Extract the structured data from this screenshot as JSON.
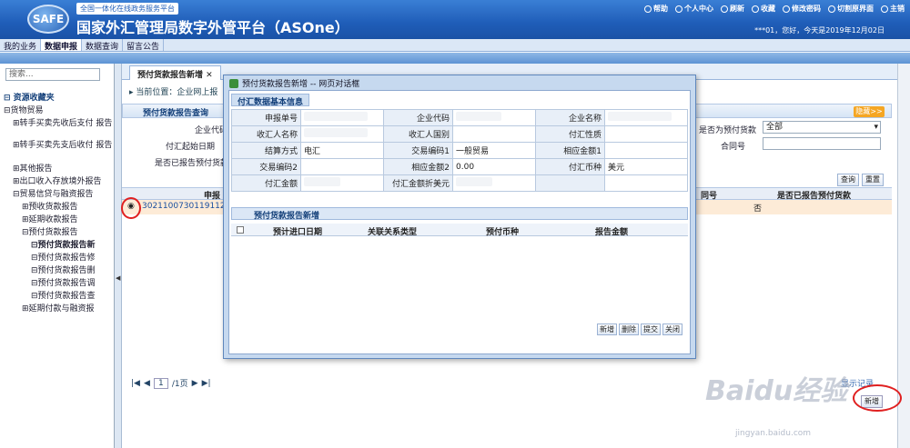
{
  "header": {
    "logo": "SAFE",
    "slogan": "全国一体化在线政务服务平台",
    "title": "国家外汇管理局数字外管平台（ASOne）",
    "links": [
      "帮助",
      "个人中心",
      "刷新",
      "收藏",
      "修改密码",
      "切割原界面",
      "主销"
    ],
    "user_info": "***01，您好，今天是2019年12月02日"
  },
  "nav": [
    "我的业务",
    "数据申报",
    "数据查询",
    "留言公告"
  ],
  "sidebar": {
    "search_placeholder": "搜索...",
    "items": [
      "⊟ 资源收藏夹",
      "⊟货物贸易",
      "⊞转手买卖先收后支付 报告",
      "⊞转手买卖先支后收付 报告",
      "⊞其他报告",
      "⊞出口收入存放境外报告",
      "⊟贸易信贷与融资报告",
      "⊞预收货款报告",
      "⊞延期收款报告",
      "⊟预付货款报告",
      "⊟预付货款报告新",
      "⊟预付货款报告修",
      "⊟预付货款报告删",
      "⊟预付货款报告调",
      "⊟预付货款报告查",
      "⊞延期付款与融资报"
    ]
  },
  "main": {
    "tab": "预付货款报告新增",
    "breadcrumb": "当前位置：企业网上报",
    "panel_title": "预付货款报告查询",
    "org_button": "隐藏>>",
    "labels": [
      "企业代码",
      "付汇起始日期",
      "是否已报告预付货款",
      "是否为预付货款",
      "合同号"
    ],
    "select_all": "全部",
    "query_btn": "查询",
    "reset_btn": "重置",
    "grid_cols": [
      "申报",
      "同号",
      "是否已报告预付货款"
    ],
    "row": {
      "id": "302110073011911251",
      "flag": "否"
    },
    "pager_page": "1",
    "pager_total": "/1页",
    "record_hint": "显示记录",
    "new_btn": "新增"
  },
  "dialog": {
    "title": "预付货款报告新增 -- 网页对话框",
    "section1": "付汇数据基本信息",
    "fields": [
      [
        "申报单号",
        "企业代码",
        "企业名称"
      ],
      [
        "收汇人名称",
        "收汇人国别",
        "付汇性质"
      ],
      [
        "结算方式",
        "交易编码1",
        "相应金额1"
      ],
      [
        "交易编码2",
        "相应金额2",
        "付汇币种"
      ],
      [
        "付汇金额",
        "付汇金额折美元",
        ""
      ]
    ],
    "values": {
      "jsfs": "电汇",
      "jybm1": "一般贸易",
      "xyje2": "0.00",
      "fhbz": "美元"
    },
    "section2": "预付货款报告新增",
    "sub_cols": [
      "预计进口日期",
      "关联关系类型",
      "预付币种",
      "报告金额"
    ],
    "buttons": [
      "新增",
      "删除",
      "提交",
      "关闭"
    ]
  },
  "watermark": {
    "brand": "Baidu经验",
    "url": "jingyan.baidu.com"
  }
}
